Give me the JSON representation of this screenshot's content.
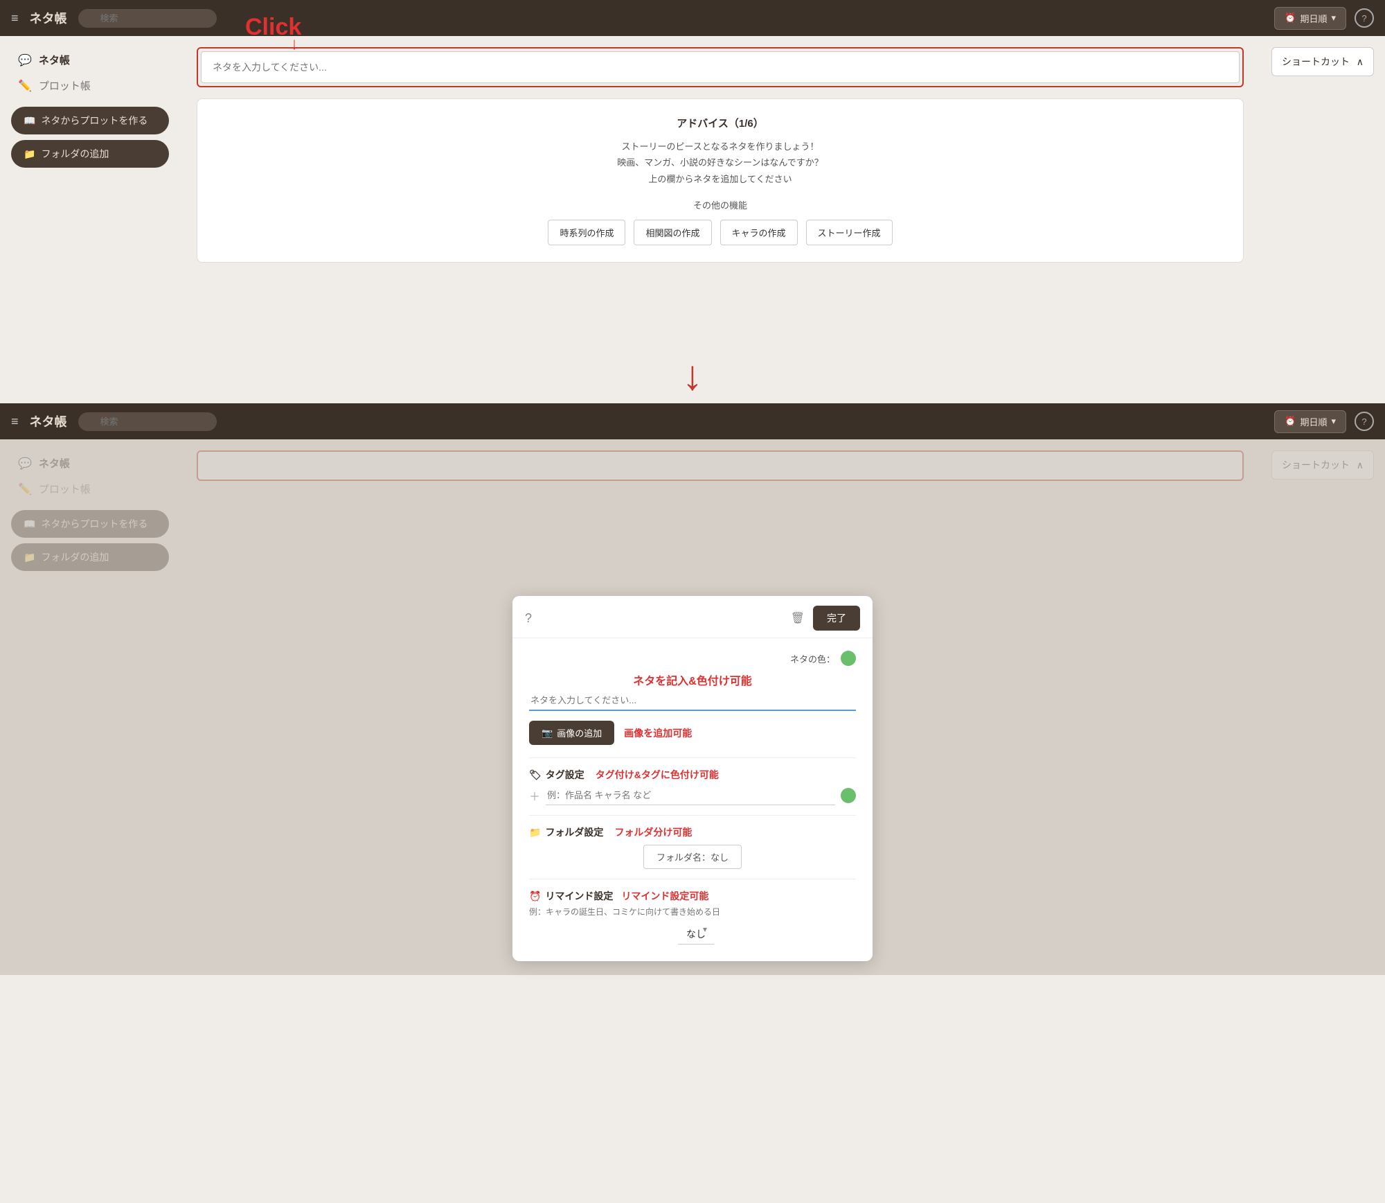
{
  "app": {
    "title": "ネタ帳",
    "search_placeholder": "検索",
    "date_btn": "期日順",
    "help": "?"
  },
  "sidebar": {
    "neta_label": "ネタ帳",
    "plot_label": "プロット帳",
    "btn_neta_plot": "ネタからプロットを作る",
    "btn_add_folder": "フォルダの追加"
  },
  "top": {
    "click_label": "Click",
    "neta_input_placeholder": "ネタを入力してください...",
    "advice_title": "アドバイス（1/6）",
    "advice_line1": "ストーリーのピースとなるネタを作りましょう！",
    "advice_line2": "映画、マンガ、小説の好きなシーンはなんですか？",
    "advice_line3": "上の欄からネタを追加してください",
    "advice_features_label": "その他の機能",
    "feature1": "時系列の作成",
    "feature2": "相関図の作成",
    "feature3": "キャラの作成",
    "feature4": "ストーリー作成",
    "shortcut_label": "ショートカット"
  },
  "modal": {
    "help_icon": "?",
    "delete_icon": "🗑",
    "done_btn": "完了",
    "section_title": "ネタを記入&色付け可能",
    "color_label": "ネタの色：",
    "neta_input_placeholder": "ネタを入力してください...",
    "image_btn": "画像の追加",
    "image_label": "画像を追加可能",
    "tag_label": "タグ設定",
    "tag_section_label": "タグ付け&タグに色付け可能",
    "tag_placeholder": "例：作品名 キャラ名 など",
    "folder_label": "フォルダ設定",
    "folder_section_label": "フォルダ分け可能",
    "folder_name_btn": "フォルダ名：なし",
    "reminder_label": "リマインド設定",
    "reminder_section_label": "リマインド設定可能",
    "reminder_example": "例：キャラの誕生日、コミケに向けて書き始める日",
    "reminder_select": "なし",
    "shortcut_label": "ショートカット"
  }
}
